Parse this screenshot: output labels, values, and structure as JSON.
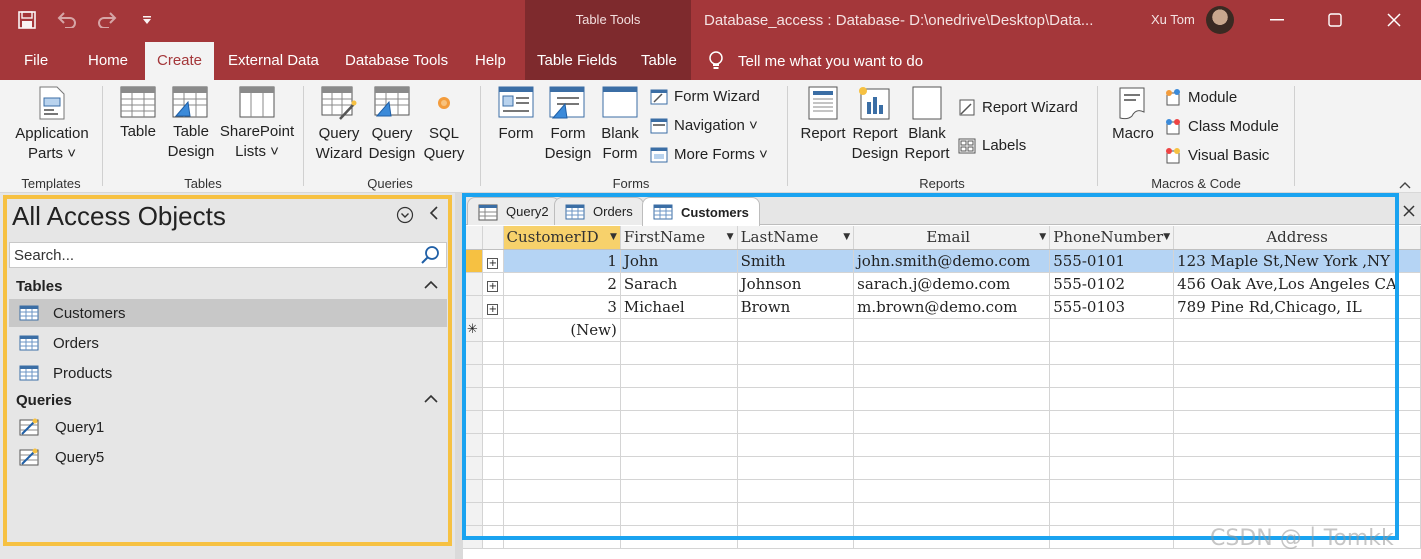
{
  "titlebar": {
    "context_group": "Table Tools",
    "document_title": "Database_access : Database- D:\\onedrive\\Desktop\\Data...",
    "user_name": "Xu Tom"
  },
  "ribbon_tabs": [
    "File",
    "Home",
    "Create",
    "External Data",
    "Database Tools",
    "Help",
    "Table Fields",
    "Table"
  ],
  "active_tab": "Create",
  "tell_me": "Tell me what you want to do",
  "ribbon": {
    "templates": {
      "label": "Templates",
      "app_parts_1": "Application",
      "app_parts_2": "Parts ˅"
    },
    "tables": {
      "label": "Tables",
      "table": "Table",
      "table_design_1": "Table",
      "table_design_2": "Design",
      "sharepoint_1": "SharePoint",
      "sharepoint_2": "Lists ˅"
    },
    "queries": {
      "label": "Queries",
      "wizard_1": "Query",
      "wizard_2": "Wizard",
      "design_1": "Query",
      "design_2": "Design",
      "sql_1": "SQL",
      "sql_2": "Query"
    },
    "forms": {
      "label": "Forms",
      "form": "Form",
      "form_design_1": "Form",
      "form_design_2": "Design",
      "blank_1": "Blank",
      "blank_2": "Form",
      "form_wizard": "Form Wizard",
      "navigation": "Navigation ˅",
      "more_forms": "More Forms ˅"
    },
    "reports": {
      "label": "Reports",
      "report": "Report",
      "report_design_1": "Report",
      "report_design_2": "Design",
      "blank_1": "Blank",
      "blank_2": "Report",
      "report_wizard": "Report Wizard",
      "labels": "Labels"
    },
    "macros": {
      "label": "Macros & Code",
      "macro": "Macro",
      "module": "Module",
      "class_module": "Class Module",
      "visual_basic": "Visual Basic"
    }
  },
  "nav": {
    "title": "All Access Objects",
    "search_placeholder": "Search...",
    "tables_header": "Tables",
    "tables": [
      "Customers",
      "Orders",
      "Products"
    ],
    "queries_header": "Queries",
    "queries": [
      "Query1",
      "Query5"
    ]
  },
  "doc_tabs": [
    "Query2",
    "Orders",
    "Customers"
  ],
  "active_doc_tab": "Customers",
  "grid": {
    "columns": [
      "CustomerID",
      "FirstName",
      "LastName",
      "Email",
      "PhoneNumber",
      "Address"
    ],
    "rows": [
      [
        "1",
        "John",
        "Smith",
        "john.smith@demo.com",
        "555-0101",
        "123 Maple St,New York ,NY"
      ],
      [
        "2",
        "Sarach",
        "Johnson",
        "sarach.j@demo.com",
        "555-0102",
        "456 Oak Ave,Los Angeles  CA"
      ],
      [
        "3",
        "Michael",
        "Brown",
        "m.brown@demo.com",
        "555-0103",
        "789 Pine Rd,Chicago,  IL"
      ]
    ],
    "new_row": "(New)"
  },
  "watermark": "CSDN @丨Tomkk",
  "colors": {
    "accent": "#a4373a",
    "context": "#7e2a2d",
    "highlight_yellow": "#f6c142",
    "highlight_blue": "#1aa3f0"
  }
}
